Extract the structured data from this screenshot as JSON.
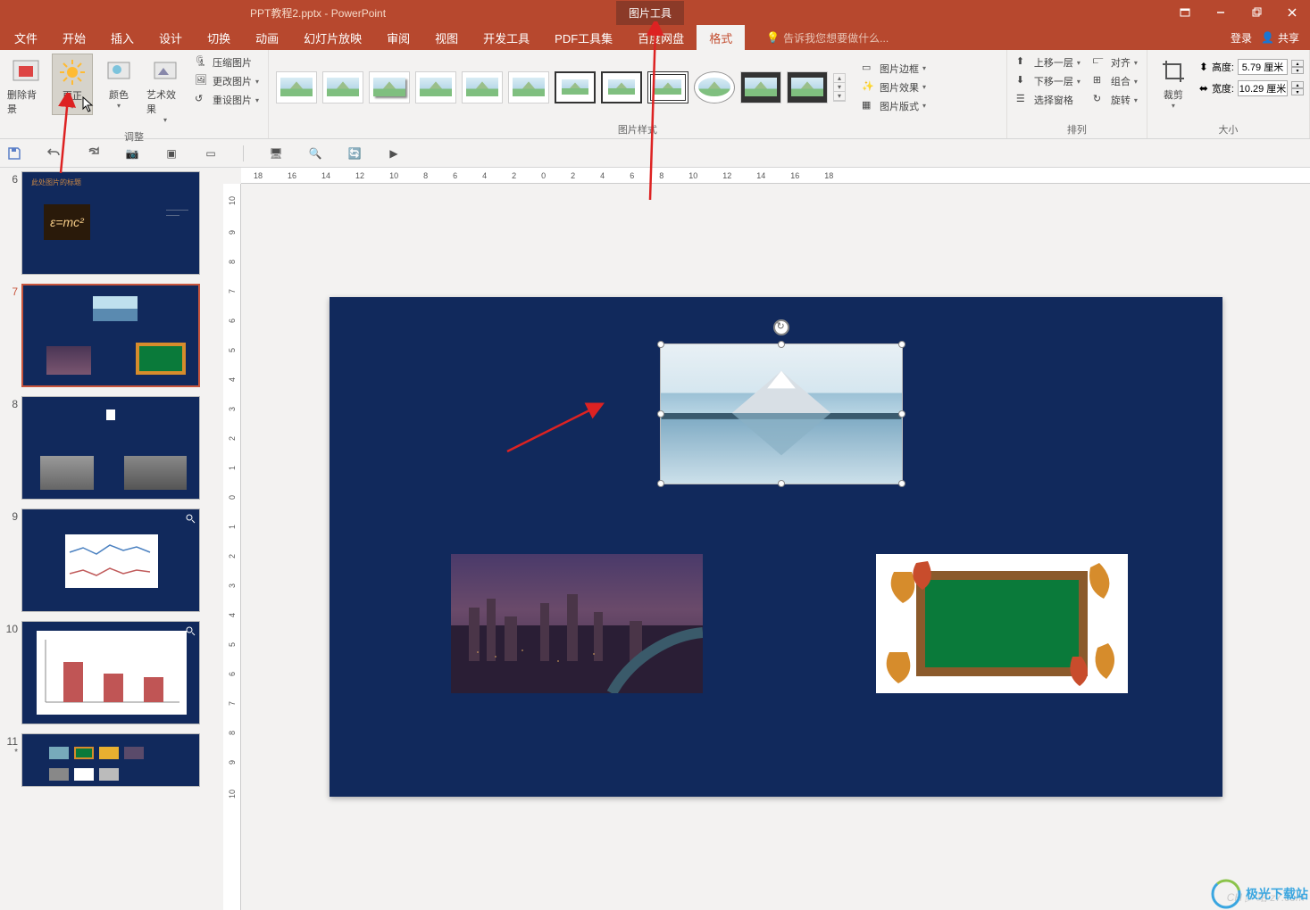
{
  "title_bar": {
    "document_title": "PPT教程2.pptx - PowerPoint",
    "context_tab": "图片工具"
  },
  "window_controls": {
    "ribbon_options_icon": "ribbon-options",
    "minimize_icon": "minimize",
    "restore_icon": "restore",
    "close_icon": "close"
  },
  "ribbon_tabs": {
    "file": "文件",
    "home": "开始",
    "insert": "插入",
    "design": "设计",
    "transitions": "切换",
    "animations": "动画",
    "slideshow": "幻灯片放映",
    "review": "审阅",
    "view": "视图",
    "developer": "开发工具",
    "pdf": "PDF工具集",
    "baidu": "百度网盘",
    "format": "格式",
    "tell_me_placeholder": "告诉我您想要做什么...",
    "login": "登录",
    "share": "共享"
  },
  "ribbon_groups": {
    "remove_bg": "删除背景",
    "corrections": "更正",
    "color": "颜色",
    "artistic": "艺术效果",
    "compress": "压缩图片",
    "change_pic": "更改图片",
    "reset_pic": "重设图片",
    "adjust": "调整",
    "pic_styles": "图片样式",
    "pic_border": "图片边框",
    "pic_effects": "图片效果",
    "pic_layout": "图片版式",
    "bring_forward": "上移一层",
    "send_backward": "下移一层",
    "selection_pane": "选择窗格",
    "align": "对齐",
    "group": "组合",
    "rotate": "旋转",
    "arrange": "排列",
    "crop": "裁剪",
    "height_label": "高度:",
    "height_value": "5.79 厘米",
    "width_label": "宽度:",
    "width_value": "10.29 厘米",
    "size": "大小"
  },
  "ruler_h": [
    "18",
    "16",
    "14",
    "12",
    "10",
    "8",
    "6",
    "4",
    "2",
    "0",
    "2",
    "4",
    "6",
    "8",
    "10",
    "12",
    "14",
    "16",
    "18"
  ],
  "ruler_v": [
    "10",
    "9",
    "8",
    "7",
    "6",
    "5",
    "4",
    "3",
    "2",
    "1",
    "0",
    "1",
    "2",
    "3",
    "4",
    "5",
    "6",
    "7",
    "8",
    "9",
    "10"
  ],
  "thumbnails": {
    "slides": [
      {
        "no": "6",
        "title": "此处图片的标题",
        "formula": "ε=mc²"
      },
      {
        "no": "7",
        "selected": true
      },
      {
        "no": "8"
      },
      {
        "no": "9"
      },
      {
        "no": "10"
      },
      {
        "no": "11",
        "modified": true
      }
    ]
  },
  "watermarks": {
    "site": "CH ▷ 站 z7.com",
    "logo_text": "极光下载站"
  }
}
